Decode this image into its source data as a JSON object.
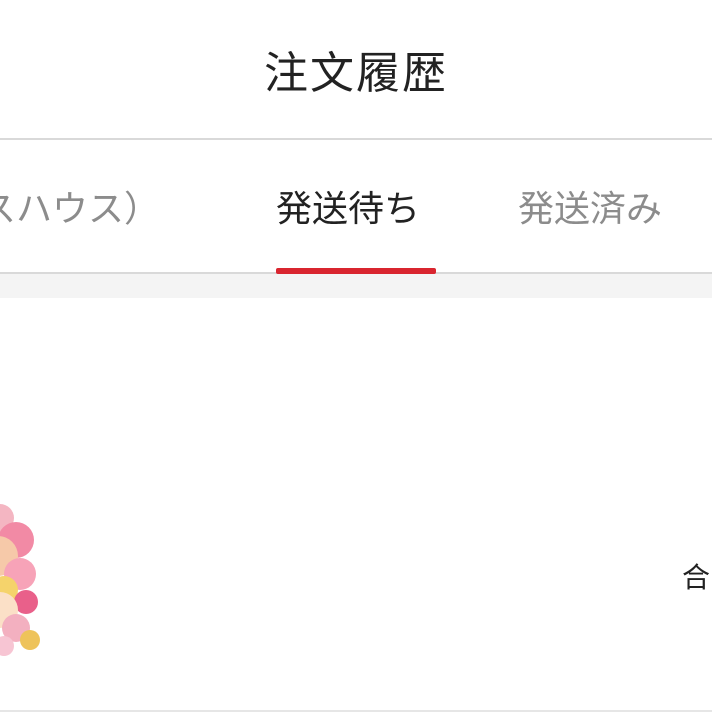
{
  "header": {
    "title": "注文履歴"
  },
  "tabs": [
    {
      "label": "スハウス）",
      "active": false
    },
    {
      "label": "発送待ち",
      "active": true
    },
    {
      "label": "発送済み",
      "active": false
    }
  ],
  "order": {
    "total_label_partial": "合"
  },
  "colors": {
    "accent": "#d9252f",
    "text_primary": "#222222",
    "text_secondary": "#8c8c8c",
    "divider": "#d9d9d9"
  },
  "icons": {
    "product": "flower-bouquet-thumbnail"
  }
}
